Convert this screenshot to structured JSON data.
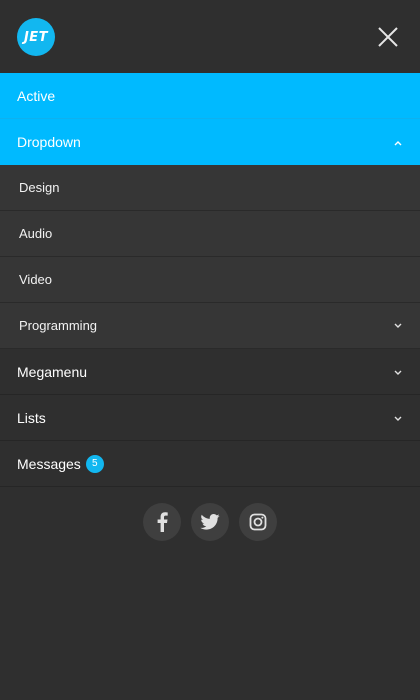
{
  "logo": {
    "text": "JET",
    "color": "#12b7f0"
  },
  "menu": {
    "items": [
      {
        "label": "Active"
      },
      {
        "label": "Dropdown"
      },
      {
        "label": "Megamenu"
      },
      {
        "label": "Lists"
      },
      {
        "label": "Messages",
        "badge": "5"
      }
    ],
    "dropdown_children": [
      {
        "label": "Design"
      },
      {
        "label": "Audio"
      },
      {
        "label": "Video"
      },
      {
        "label": "Programming"
      }
    ]
  },
  "colors": {
    "accent": "#00baff",
    "background": "#2f2f2f",
    "submenu_background": "#363636"
  },
  "icons": {
    "close": "close-icon",
    "social": [
      "facebook-icon",
      "twitter-icon",
      "instagram-icon"
    ]
  }
}
